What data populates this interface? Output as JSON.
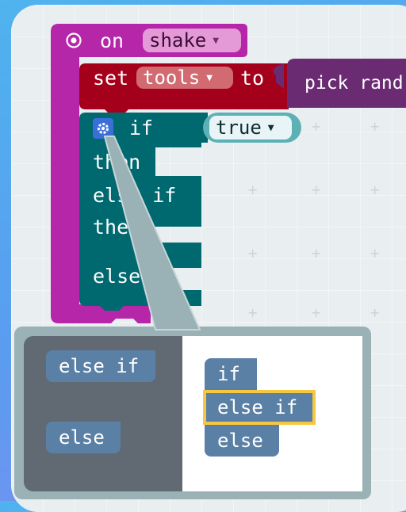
{
  "event_block": {
    "label": "on",
    "event_value": "shake",
    "color": "#b526a9"
  },
  "set_block": {
    "label": "set",
    "variable": "tools",
    "to_label": "to",
    "color": "#a5001b"
  },
  "pick_block": {
    "label": "pick rand",
    "color": "#6b2b73"
  },
  "if_block": {
    "if_label": "if",
    "condition_value": "true",
    "then_label": "then",
    "else_if_label": "else if",
    "then2_label": "then",
    "else_label": "else",
    "color": "#006970",
    "gear_icon": "gear-icon"
  },
  "mutator": {
    "palette_else_if": "else if",
    "palette_else": "else",
    "stack_if": "if",
    "stack_else_if": "else if",
    "stack_else": "else",
    "block_color": "#5b80a5",
    "highlight_color": "#f6c743"
  }
}
